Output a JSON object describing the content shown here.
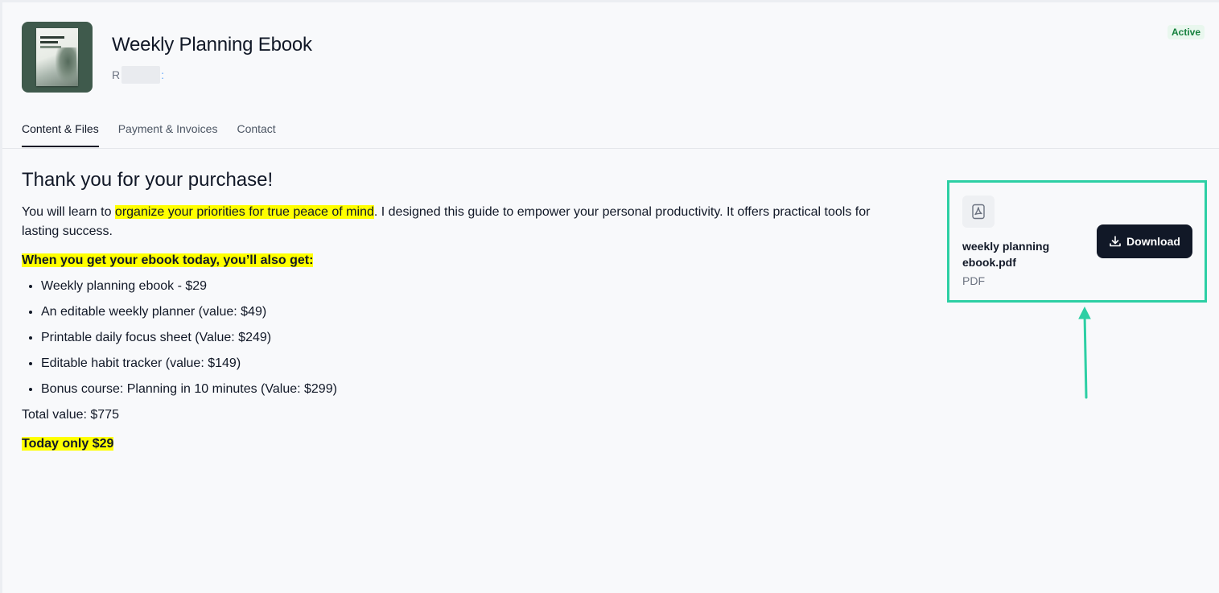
{
  "header": {
    "title": "Weekly Planning Ebook",
    "seller_initial": "R",
    "seller_tail": ":",
    "status": "Active"
  },
  "tabs": [
    {
      "label": "Content & Files",
      "active": true
    },
    {
      "label": "Payment & Invoices",
      "active": false
    },
    {
      "label": "Contact",
      "active": false
    }
  ],
  "content": {
    "heading": "Thank you for your purchase!",
    "intro_before": "You will learn to ",
    "intro_highlight": "organize your priorities for true peace of mind",
    "intro_after": ". I designed this guide to empower your personal productivity. It offers practical tools for lasting success.",
    "subheading": "When you get your ebook today, you’ll also get:",
    "bullets": [
      "Weekly planning ebook - $29",
      "An editable weekly planner (value: $49)",
      "Printable daily focus sheet (Value: $249)",
      "Editable habit tracker (value: $149)",
      "Bonus course: Planning in 10 minutes (Value: $299)"
    ],
    "total": "Total value: $775",
    "today": "Today only $29"
  },
  "file": {
    "name": "weekly planning ebook.pdf",
    "type": "PDF",
    "download_label": "Download",
    "icon": "pdf-file-icon"
  },
  "colors": {
    "highlight": "#ffff00",
    "annotation": "#2dcfa4",
    "button": "#111827",
    "status": "#15803d"
  }
}
